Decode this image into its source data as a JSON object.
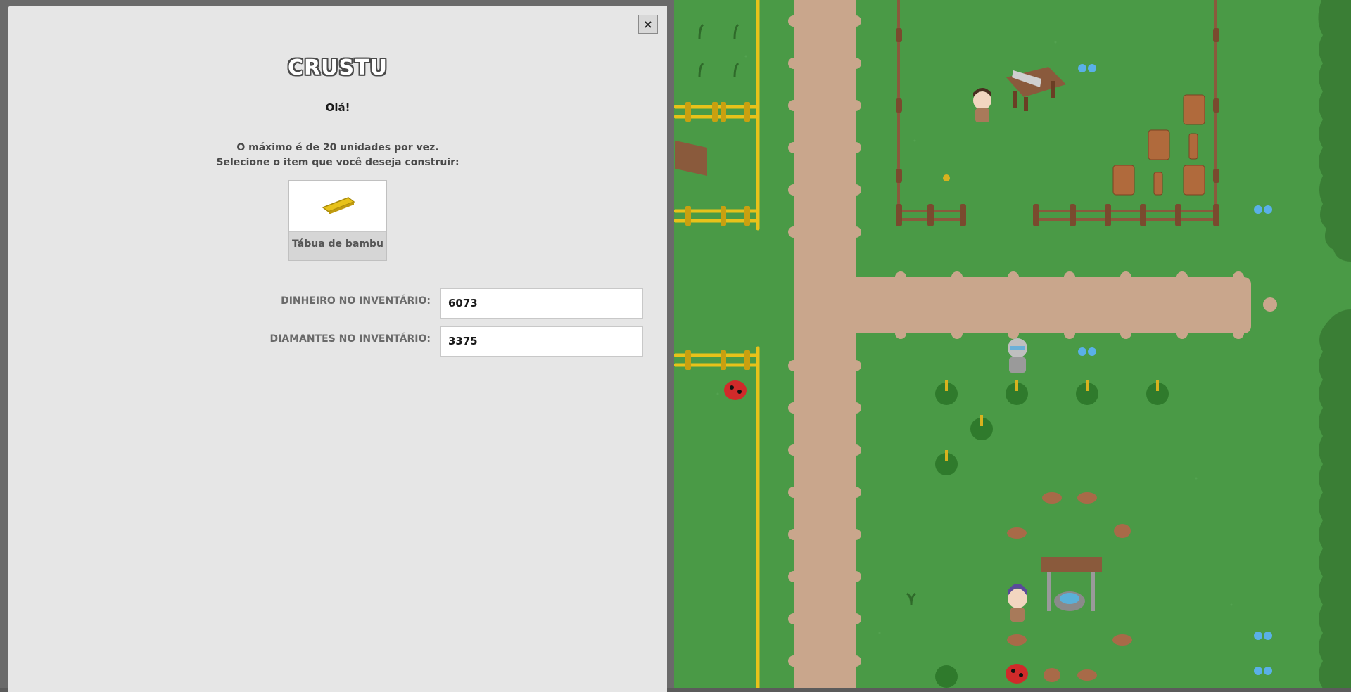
{
  "dialog": {
    "close_label": "×",
    "npc_name": "CRUSTU",
    "greeting": "Olá!",
    "info_line_1": "O máximo é de 20 unidades por vez.",
    "info_line_2": "Selecione o item que você deseja construir:",
    "items": [
      {
        "label": "Tábua de bambu",
        "icon": "bamboo-plank-icon"
      }
    ],
    "money_label": "DINHEIRO NO INVENTÁRIO:",
    "money_value": "6073",
    "diamonds_label": "DIAMANTES NO INVENTÁRIO:",
    "diamonds_value": "3375"
  },
  "colors": {
    "grass": "#4a9a46",
    "path": "#c9a68c",
    "fence_wood": "#8a5a3c",
    "fence_bamboo": "#e8c21a",
    "dialog_bg": "#e6e6e6"
  }
}
